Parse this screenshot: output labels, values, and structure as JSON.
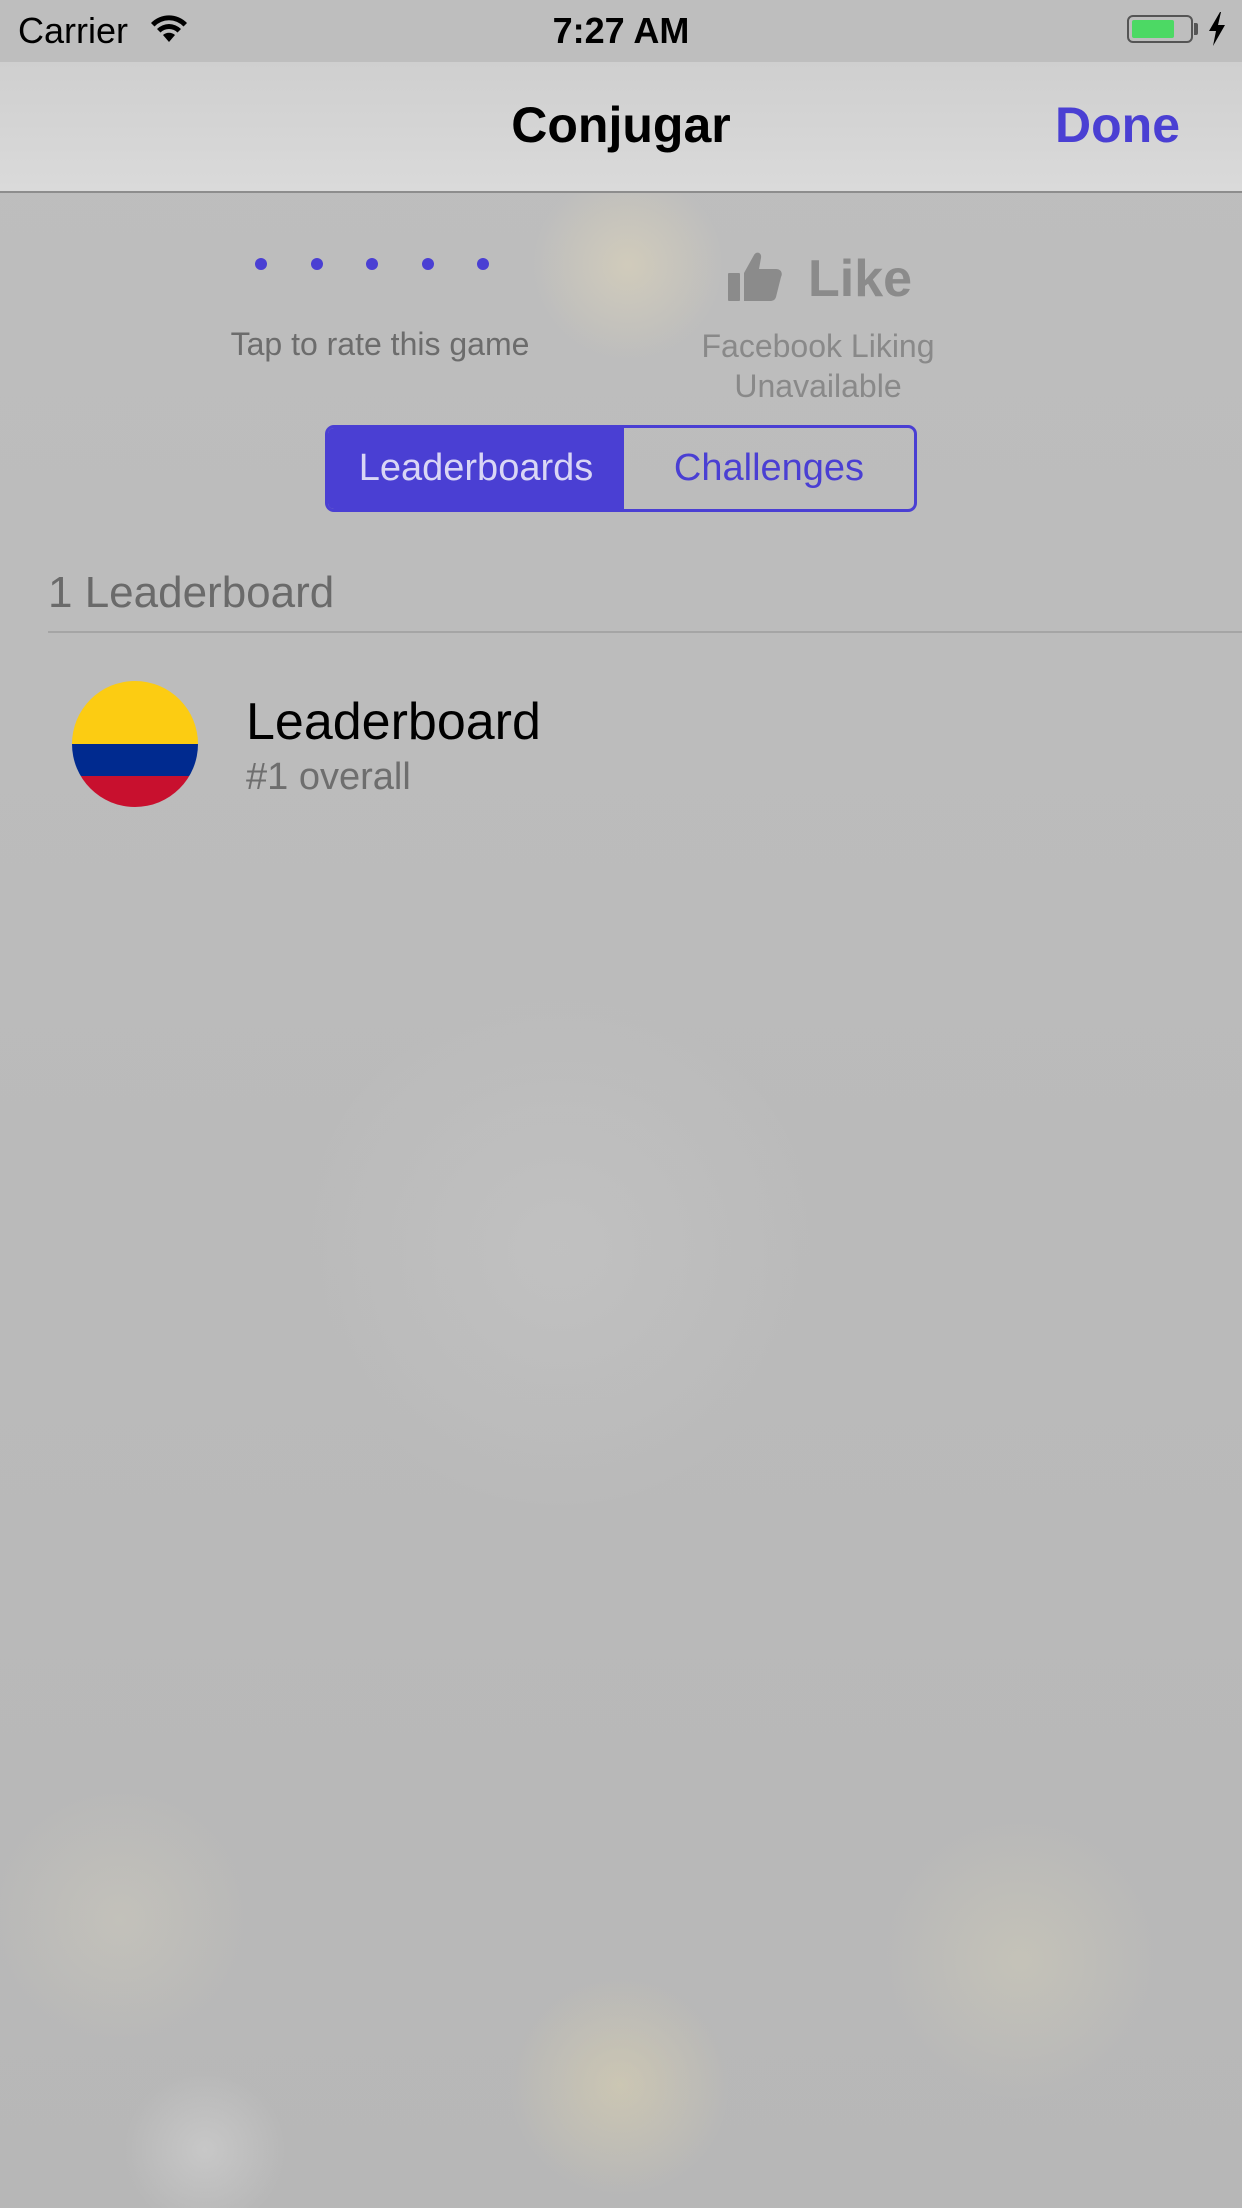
{
  "status_bar": {
    "carrier": "Carrier",
    "time": "7:27 AM",
    "battery_level": 0.75,
    "battery_color": "#4cd964"
  },
  "nav": {
    "title": "Conjugar",
    "done_label": "Done"
  },
  "rating": {
    "dot_count": 5,
    "label": "Tap to rate this game"
  },
  "like": {
    "icon": "thumbs-up-icon",
    "label": "Like",
    "status_line1": "Facebook Liking",
    "status_line2": "Unavailable"
  },
  "segments": {
    "leaderboards": "Leaderboards",
    "challenges": "Challenges",
    "selected": "leaderboards"
  },
  "section": {
    "header": "1 Leaderboard"
  },
  "leaderboards": [
    {
      "title": "Leaderboard",
      "subtitle": "#1 overall",
      "icon": "colombia-flag-icon",
      "flag_colors": [
        "#fccc12",
        "#002a8f",
        "#c8102e"
      ]
    }
  ],
  "colors": {
    "accent": "#4a3fd3"
  }
}
